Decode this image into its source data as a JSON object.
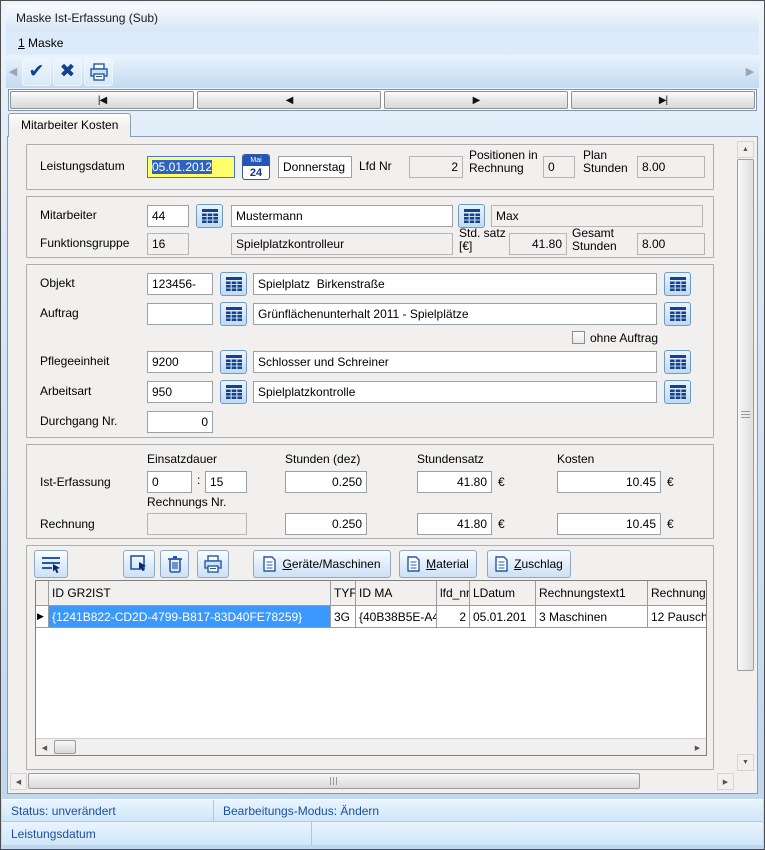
{
  "window": {
    "title": "Maske Ist-Erfassung (Sub)"
  },
  "menu": {
    "maske": "1 Maske"
  },
  "icons": {
    "up": "▲",
    "down": "▼",
    "left": "◀",
    "right": "▶",
    "confirm": "✔",
    "cancel": "✖",
    "row_marker": "▶"
  },
  "nav": {
    "first": "|◀",
    "prev": "◀",
    "next": "▶",
    "last": "▶|"
  },
  "tab": {
    "label": "Mitarbeiter Kosten"
  },
  "head": {
    "leistungsdatum_label": "Leistungsdatum",
    "leistungsdatum": "05.01.2012",
    "calendar_month": "Mai",
    "calendar_day": "24",
    "weekday": "Donnerstag",
    "lfdnr_label": "Lfd Nr",
    "lfdnr": "2",
    "positionen_label": "Positionen in Rechnung",
    "positionen": "0",
    "plan_label": "Plan Stunden",
    "plan_stunden": "8.00"
  },
  "mitarbeiter": {
    "label": "Mitarbeiter",
    "id": "44",
    "nachname": "Mustermann",
    "vorname": "Max",
    "funktionsgruppe_label": "Funktionsgruppe",
    "funktionsgruppe_id": "16",
    "funktionsgruppe_name": "Spielplatzkontrolleur",
    "stdsatz_label": "Std. satz [€]",
    "stdsatz": "41.80",
    "gesamt_label": "Gesamt Stunden",
    "gesamt_stunden": "8.00"
  },
  "objekt": {
    "label": "Objekt",
    "id": "123456-",
    "name": "Spielplatz  Birkenstraße"
  },
  "auftrag": {
    "label": "Auftrag",
    "id": "",
    "name": "Grünflächenunterhalt 2011 - Spielplätze",
    "ohne_auftrag_label": "ohne Auftrag"
  },
  "pflegeeinheit": {
    "label": "Pflegeeinheit",
    "id": "9200",
    "name": "Schlosser und Schreiner"
  },
  "arbeitsart": {
    "label": "Arbeitsart",
    "id": "950",
    "name": "Spielplatzkontrolle"
  },
  "durchgang": {
    "label": "Durchgang Nr.",
    "value": "0"
  },
  "erfassung": {
    "col_einsatzdauer": "Einsatzdauer",
    "col_stunden": "Stunden (dez)",
    "col_stundensatz": "Stundensatz",
    "col_kosten": "Kosten",
    "time_sep": ":",
    "euro": "€",
    "ist_label": "Ist-Erfassung",
    "ist_stunden_h": "0",
    "ist_minuten": "15",
    "ist_stunden_dez": "0.250",
    "ist_stundensatz": "41.80",
    "ist_kosten": "10.45",
    "rechnungsnr_label": "Rechnungs Nr.",
    "rechnungsnr": "",
    "rechnung_label": "Rechnung",
    "re_stunden_dez": "0.250",
    "re_stundensatz": "41.80",
    "re_kosten": "10.45"
  },
  "detail": {
    "buttons": {
      "geraete": "Geräte/Maschinen",
      "material": "Material",
      "zuschlag": "Zuschlag"
    },
    "table": {
      "columns": [
        "ID GR2IST",
        "TYF",
        "ID MA",
        "lfd_nr",
        "LDatum",
        "Rechnungstext1",
        "Rechnung"
      ],
      "row": {
        "id_gr2ist": "{1241B822-CD2D-4799-B817-83D40FE78259}",
        "tyf": "3G",
        "id_ma": "{40B38B5E-A4",
        "lfd_nr": "2",
        "ldatum": "05.01.201",
        "rechnungstext1": "3 Maschinen",
        "rechnung": "12 Pausch"
      }
    }
  },
  "statusbar": {
    "status": "Status: unverändert",
    "modus": "Bearbeitungs-Modus: Ändern",
    "feld": "Leistungsdatum"
  }
}
